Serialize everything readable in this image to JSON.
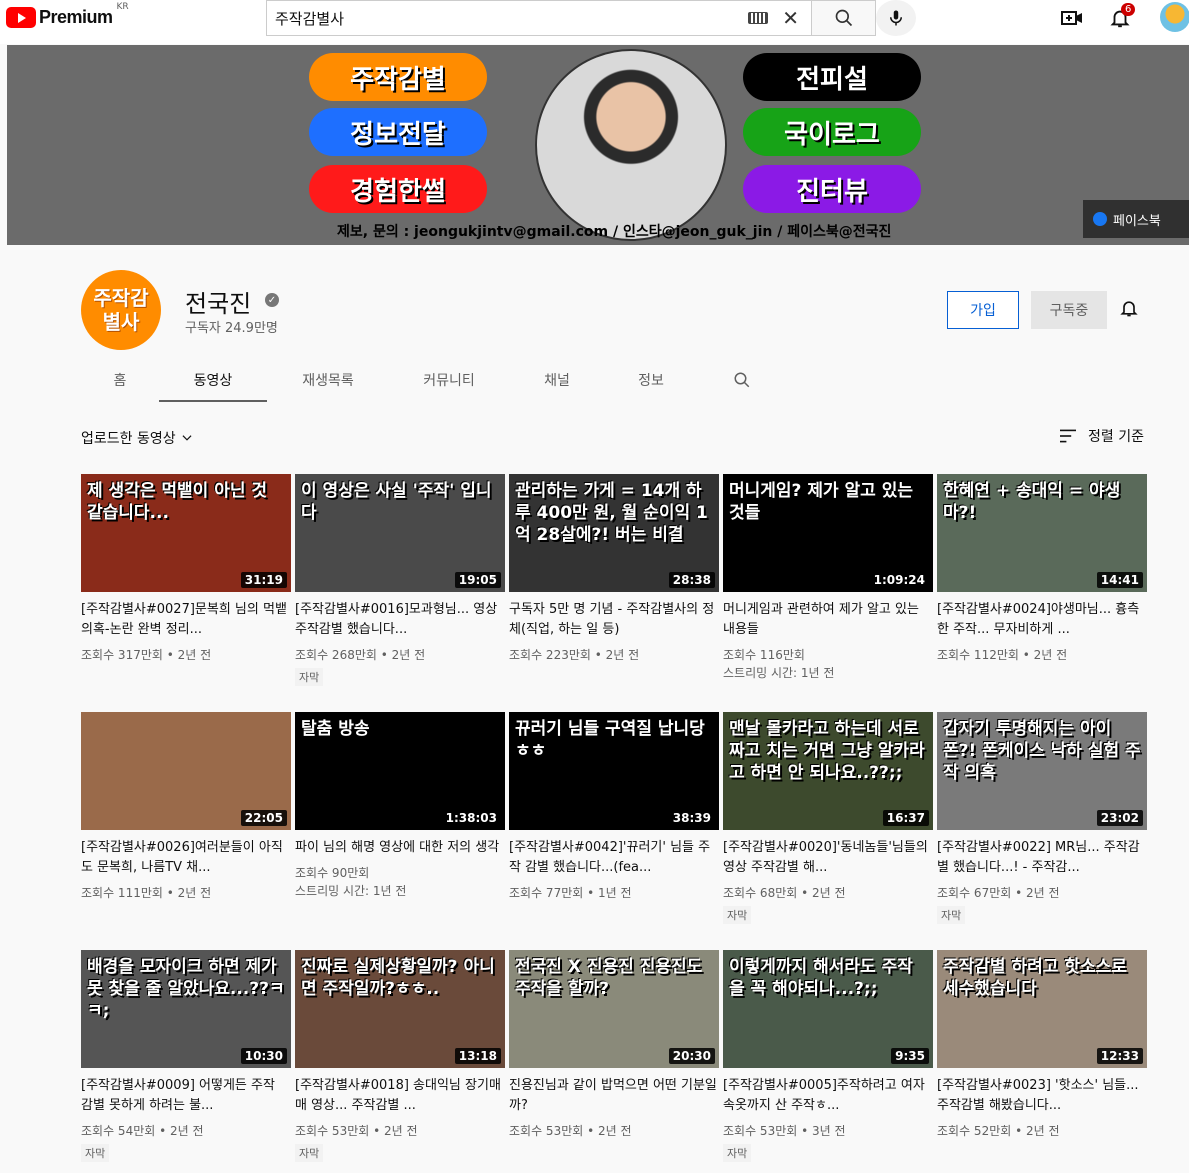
{
  "topbar": {
    "logo_text": "Premium",
    "logo_region": "KR",
    "search_value": "주작감별사",
    "notifications_count": "6"
  },
  "banner": {
    "pills_left": [
      {
        "label": "주작감별",
        "color": "#ff8c00"
      },
      {
        "label": "정보전달",
        "color": "#1e6fff"
      },
      {
        "label": "경험한썰",
        "color": "#ff1a1a"
      }
    ],
    "pills_right": [
      {
        "label": "전피설",
        "color": "#000000"
      },
      {
        "label": "국이로그",
        "color": "#17a317"
      },
      {
        "label": "진터뷰",
        "color": "#8b1ae6"
      }
    ],
    "contact": "제보, 문의 : jeongukjintv@gmail.com  /  인스타@jeon_guk_jin  /  페이스북@전국진",
    "facebook_link": "페이스북"
  },
  "channel": {
    "avatar_text": "주작감별사",
    "name": "전국진",
    "subscribers": "구독자 24.9만명",
    "join_label": "가입",
    "subscribed_label": "구독중"
  },
  "tabs": [
    "홈",
    "동영상",
    "재생목록",
    "커뮤니티",
    "채널",
    "정보"
  ],
  "active_tab": "동영상",
  "section": {
    "title": "업로드한 동영상",
    "sort_label": "정렬 기준"
  },
  "videos": [
    {
      "thumb_text": "제 생각은 먹뱉이 아닌 것 같습니다...",
      "thumb_color": "#8a2b1a",
      "duration": "31:19",
      "title": "[주작감별사#0027]문복희 님의 먹뱉 의혹-논란 완벽 정리...",
      "views": "조회수 317만회",
      "age": "2년 전",
      "badge": ""
    },
    {
      "thumb_text": "이 영상은 사실 '주작' 입니다",
      "thumb_color": "#4a4a4a",
      "duration": "19:05",
      "title": "[주작감별사#0016]모과형님... 영상 주작감별 했습니다...",
      "views": "조회수 268만회",
      "age": "2년 전",
      "badge": "자막"
    },
    {
      "thumb_text": "관리하는 가게 = 14개 하루 400만 원, 월 순이익 1억 28살에?! 버는 비결",
      "thumb_color": "#333333",
      "duration": "28:38",
      "title": "구독자 5만 명 기념 - 주작감별사의 정체(직업, 하는 일 등)",
      "views": "조회수 223만회",
      "age": "2년 전",
      "badge": ""
    },
    {
      "thumb_text": "머니게임? 제가 알고 있는 것들",
      "thumb_color": "#000000",
      "duration": "1:09:24",
      "title": "머니게임과 관련하여 제가 알고 있는 내용들",
      "views": "조회수 116만회",
      "age": "스트리밍 시간: 1년 전",
      "badge": ""
    },
    {
      "thumb_text": "한혜연 + 송대익 = 야생마?!",
      "thumb_color": "#5a6a5a",
      "duration": "14:41",
      "title": "[주작감별사#0024]야생마님... 흉측한 주작... 무자비하게 ...",
      "views": "조회수 112만회",
      "age": "2년 전",
      "badge": ""
    },
    {
      "thumb_text": "",
      "thumb_color": "#9a6a4a",
      "duration": "22:05",
      "title": "[주작감별사#0026]여러분들이 아직도 문복희, 나름TV 채...",
      "views": "조회수 111만회",
      "age": "2년 전",
      "badge": ""
    },
    {
      "thumb_text": "탈춤 방송",
      "thumb_color": "#000000",
      "duration": "1:38:03",
      "title": "파이 님의 해명 영상에 대한 저의 생각",
      "views": "조회수 90만회",
      "age": "스트리밍 시간: 1년 전",
      "badge": ""
    },
    {
      "thumb_text": "뀨러기 님들 구역질 납니당ㅎㅎ",
      "thumb_color": "#000000",
      "duration": "38:39",
      "title": "[주작감별사#0042]'뀨러기' 님들 주작 감별 했습니다...(fea...",
      "views": "조회수 77만회",
      "age": "1년 전",
      "badge": ""
    },
    {
      "thumb_text": "맨날 몰카라고 하는데 서로 짜고 치는 거면 그냥 알카라고 하면 안 되나요..??;;",
      "thumb_color": "#3d4a2d",
      "duration": "16:37",
      "title": "[주작감별사#0020]'동네놈들'님들의 영상 주작감별 해...",
      "views": "조회수 68만회",
      "age": "2년 전",
      "badge": "자막"
    },
    {
      "thumb_text": "갑자기 투명해지는 아이폰?! 폰케이스 낙하 실험 주작 의혹",
      "thumb_color": "#7a7a7a",
      "duration": "23:02",
      "title": "[주작감별사#0022] MR님... 주작감별 했습니다...! - 주작감...",
      "views": "조회수 67만회",
      "age": "2년 전",
      "badge": "자막"
    },
    {
      "thumb_text": "배경을 모자이크 하면 제가 못 찾을 줄 알았나요...??ㅋㅋ;",
      "thumb_color": "#555555",
      "duration": "10:30",
      "title": "[주작감별사#0009] 어떻게든 주작 감별 못하게 하려는 불...",
      "views": "조회수 54만회",
      "age": "2년 전",
      "badge": "자막"
    },
    {
      "thumb_text": "진짜로 실제상황일까? 아니면 주작일까?ㅎㅎ..",
      "thumb_color": "#6a4a3a",
      "duration": "13:18",
      "title": "[주작감별사#0018] 송대익님 장기매매 영상... 주작감별 ...",
      "views": "조회수 53만회",
      "age": "2년 전",
      "badge": "자막"
    },
    {
      "thumb_text": "전국진 X 진용진 진용진도 주작을 할까?",
      "thumb_color": "#8a8a7a",
      "duration": "20:30",
      "title": "진용진님과 같이 밥먹으면 어떤 기분일까?",
      "views": "조회수 53만회",
      "age": "2년 전",
      "badge": ""
    },
    {
      "thumb_text": "이렇게까지 해서라도 주작을 꼭 해야되나...?;;",
      "thumb_color": "#4a5a4a",
      "duration": "9:35",
      "title": "[주작감별사#0005]주작하려고 여자 속옷까지 산 주작ㅎ...",
      "views": "조회수 53만회",
      "age": "3년 전",
      "badge": "자막"
    },
    {
      "thumb_text": "주작감별 하려고 핫소스로 세수했습니다",
      "thumb_color": "#9a8a7a",
      "duration": "12:33",
      "title": "[주작감별사#0023] '핫소스' 님들... 주작감별 해봤습니다...",
      "views": "조회수 52만회",
      "age": "2년 전",
      "badge": ""
    }
  ]
}
